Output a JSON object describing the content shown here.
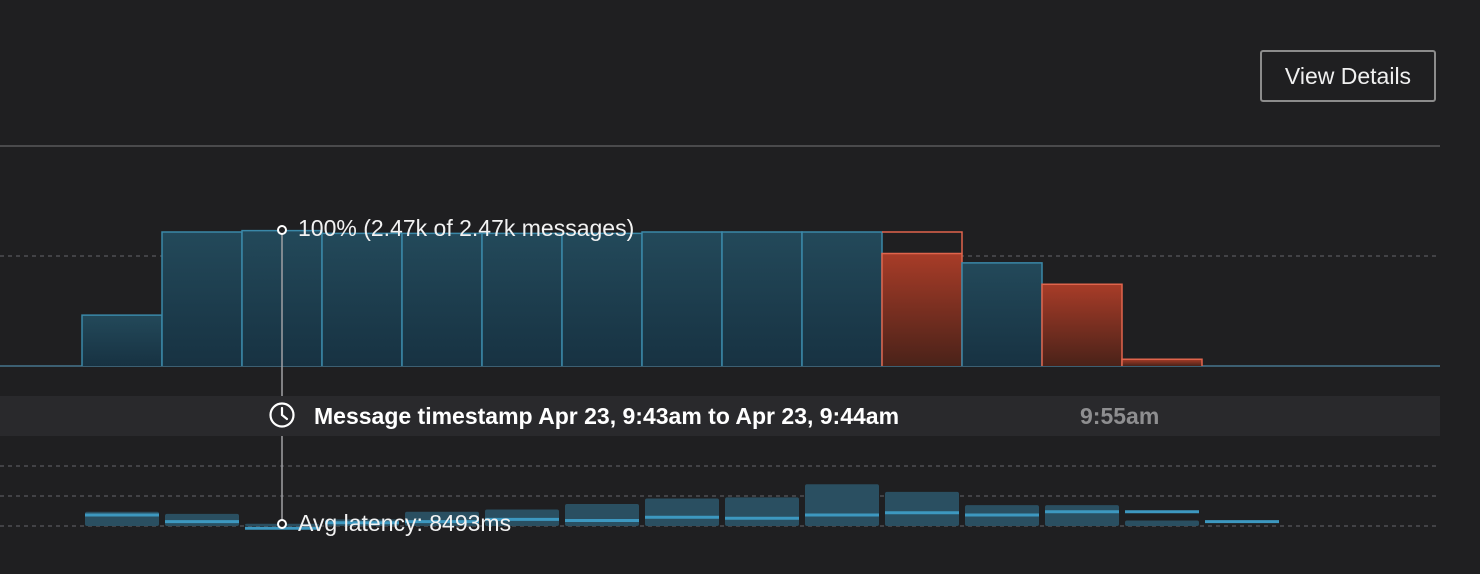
{
  "toolbar": {
    "view_details_label": "View Details"
  },
  "time_axis": {
    "selected_range_label": "Message timestamp Apr 23, 9:43am to Apr 23, 9:44am",
    "tick_label": "9:55am",
    "clock_icon": "clock-icon"
  },
  "tooltip": {
    "messages_label": "100% (2.47k of 2.47k messages)",
    "latency_label": "Avg latency: 8493ms"
  },
  "colors": {
    "ok_fill_top": "#23495a",
    "ok_fill_bottom": "#173242",
    "ok_stroke": "#3a88a8",
    "error_fill_top": "#a83c28",
    "error_fill_bottom": "#4a2219",
    "error_stroke": "#e0644c",
    "latency_fill": "#2a4f61",
    "latency_line": "#3d98c0",
    "background": "#1f1f21"
  },
  "chart_data": [
    {
      "type": "bar",
      "description": "Message count histogram (stepped), share of max per bucket",
      "buckets": 16,
      "series": [
        {
          "name": "",
          "values": [
            0,
            0.38,
            1.0,
            1.01,
            0.99,
            0.99,
            0.99,
            0.99,
            1.0,
            1.0,
            1.0,
            0.84,
            0.77,
            0.61,
            0.05,
            0
          ],
          "status": [
            "ok",
            "ok",
            "ok",
            "ok",
            "ok",
            "ok",
            "ok",
            "ok",
            "ok",
            "ok",
            "ok",
            "error",
            "ok",
            "error",
            "error",
            "ok"
          ]
        }
      ],
      "error_overlay_outline": [
        null,
        null,
        null,
        null,
        null,
        null,
        null,
        null,
        null,
        null,
        null,
        1.0,
        null,
        null,
        null,
        null
      ],
      "ylim": [
        0,
        1.2
      ],
      "grid": true
    },
    {
      "type": "bar",
      "description": "Average latency per bucket (range boxes with average line)",
      "buckets": 16,
      "avg": [
        0,
        0.1,
        0.04,
        -0.02,
        0.03,
        0.04,
        0.06,
        0.05,
        0.08,
        0.07,
        0.1,
        0.12,
        0.1,
        0.13,
        0.13,
        0.04
      ],
      "high": [
        0,
        0.13,
        0.11,
        0.02,
        0.06,
        0.13,
        0.15,
        0.2,
        0.25,
        0.26,
        0.38,
        0.31,
        0.19,
        0.19,
        0.05,
        0
      ],
      "ylim": [
        -0.05,
        1.0
      ],
      "grid": true
    }
  ]
}
